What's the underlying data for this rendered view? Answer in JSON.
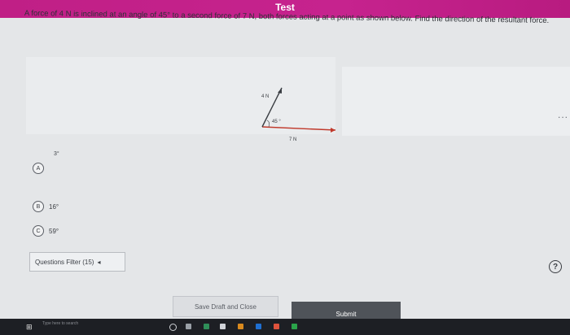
{
  "header": {
    "title": "Test"
  },
  "question": {
    "text": "A force of 4 N is inclined at an angle of 45° to a second force of 7 N, both forces acting at a point as shown below. Find the direction of the resultant force."
  },
  "diagram": {
    "label_top": "4 N",
    "label_angle": "45 °",
    "label_bottom": "7 N"
  },
  "options": [
    {
      "letter": "A",
      "value": "3°"
    },
    {
      "letter": "B",
      "value": "16°"
    },
    {
      "letter": "C",
      "value": "59°"
    }
  ],
  "filter": {
    "label": "Questions Filter (15)",
    "arrow": "◂"
  },
  "help": {
    "symbol": "?"
  },
  "buttons": {
    "save_draft": "Save Draft and Close",
    "submit": "Submit"
  },
  "taskbar": {
    "search_placeholder": "Type here to search"
  },
  "more": {
    "dots": "..."
  }
}
